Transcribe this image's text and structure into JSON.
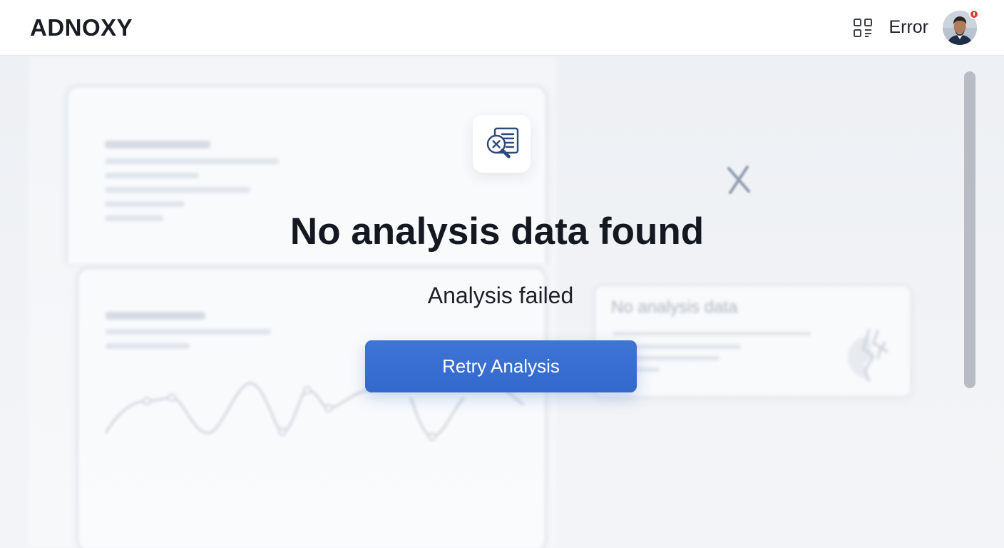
{
  "header": {
    "logo": "ADNOXY",
    "status_text": "Error",
    "has_notification": true
  },
  "empty_state": {
    "icon": "search-document-error-icon",
    "title": "No analysis data found",
    "subtitle": "Analysis failed",
    "retry_label": "Retry Analysis"
  },
  "background": {
    "side_card_title": "No analysis data"
  },
  "colors": {
    "primary_button": "#3469cc",
    "icon_accent": "#2f4a7a",
    "notification": "#e53935",
    "page_background": "#eef1f5"
  }
}
